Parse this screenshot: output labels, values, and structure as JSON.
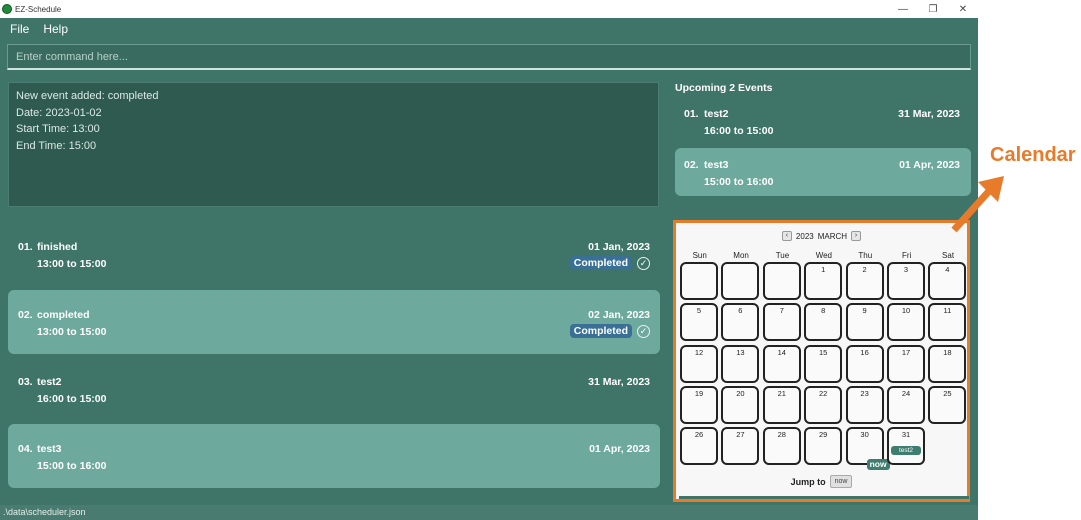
{
  "window": {
    "title": "EZ-Schedule",
    "controls": [
      "—",
      "❐",
      "✕"
    ]
  },
  "menu": {
    "items": [
      "File",
      "Help"
    ]
  },
  "command": {
    "placeholder": "Enter command here..."
  },
  "result": {
    "lines": [
      "New event added: completed",
      "Date: 2023-01-02",
      "Start Time: 13:00",
      "End Time: 15:00"
    ]
  },
  "events": [
    {
      "index": "01.",
      "name": "finished",
      "date": "01 Jan, 2023",
      "time": "13:00 to 15:00",
      "status": "Completed"
    },
    {
      "index": "02.",
      "name": "completed",
      "date": "02 Jan, 2023",
      "time": "13:00 to 15:00",
      "status": "Completed"
    },
    {
      "index": "03.",
      "name": "test2",
      "date": "31 Mar, 2023",
      "time": "16:00 to 15:00",
      "status": ""
    },
    {
      "index": "04.",
      "name": "test3",
      "date": "01 Apr, 2023",
      "time": "15:00 to 16:00",
      "status": ""
    }
  ],
  "upcoming": {
    "title": "Upcoming 2 Events",
    "items": [
      {
        "index": "01.",
        "name": "test2",
        "date": "31 Mar, 2023",
        "time": "16:00 to 15:00"
      },
      {
        "index": "02.",
        "name": "test3",
        "date": "01 Apr, 2023",
        "time": "15:00 to 16:00"
      }
    ]
  },
  "calendar": {
    "year": "2023",
    "month": "MARCH",
    "prev_icon": "‹",
    "next_icon": "›",
    "weekdays": [
      "Sun",
      "Mon",
      "Tue",
      "Wed",
      "Thu",
      "Fri",
      "Sat"
    ],
    "first_weekday_index": 3,
    "days_in_month": 31,
    "leading_blank_cells": 3,
    "now_day": 30,
    "now_label": "now",
    "event_days": [
      {
        "day": 31,
        "label": "test2"
      }
    ],
    "jump_label": "Jump to",
    "jump_button": "now"
  },
  "status_bar": {
    "path": ".\\data\\scheduler.json"
  },
  "annotation": {
    "label": "Calendar",
    "color": "#e87b2a"
  }
}
